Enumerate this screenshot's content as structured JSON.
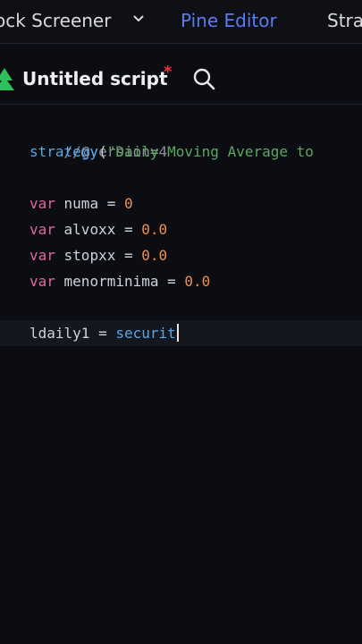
{
  "tabs": [
    {
      "label": "ock Screener",
      "active": false
    },
    {
      "label": "Pine Editor",
      "active": true
    },
    {
      "label": "Stra",
      "active": false
    }
  ],
  "script": {
    "title": "Untitled script",
    "unsaved_marker": "*"
  },
  "code": {
    "line1": "//@version=4",
    "line2_func": "strategy",
    "line2_paren": "(",
    "line2_string": "\"Daily Moving Average to",
    "line4_kw": "var",
    "line4_name": " numa = ",
    "line4_val": "0",
    "line5_kw": "var",
    "line5_name": " alvoxx = ",
    "line5_val": "0.0",
    "line6_kw": "var",
    "line6_name": " stopxx = ",
    "line6_val": "0.0",
    "line7_kw": "var",
    "line7_name": " menorminima = ",
    "line7_val": "0.0",
    "line9_name": "ldaily1 = ",
    "line9_func": "securit"
  },
  "colors": {
    "accent": "#5b7cf0",
    "unsaved": "#f0323c",
    "logo": "#2fbf5b",
    "background": "#0b0d12"
  },
  "icons": [
    "chevron-down-icon",
    "pine-logo-icon",
    "search-icon"
  ]
}
